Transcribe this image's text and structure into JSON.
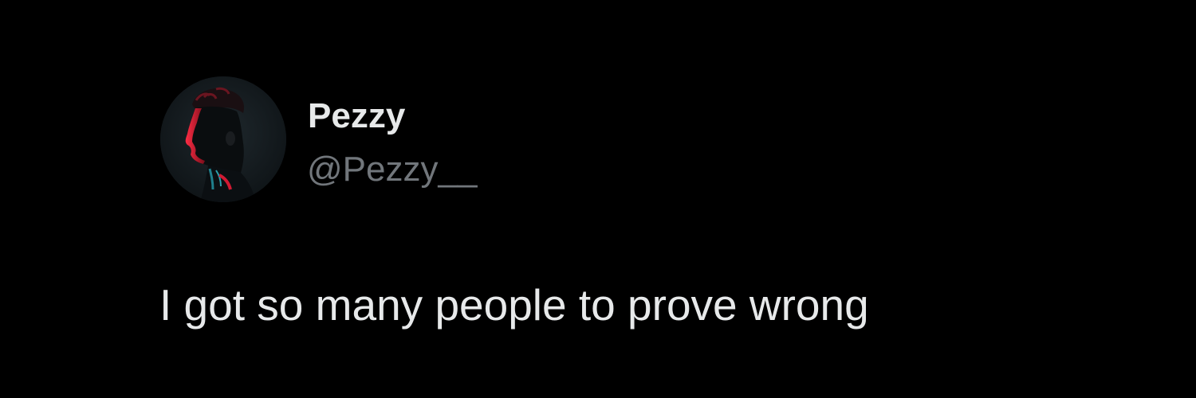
{
  "tweet": {
    "author": {
      "display_name": "Pezzy",
      "handle": "@Pezzy__",
      "avatar_icon": "profile-silhouette-icon"
    },
    "text": "I got so many people to prove wrong"
  },
  "colors": {
    "background": "#000000",
    "primary_text": "#e7e9ea",
    "secondary_text": "#71767b",
    "avatar_accent": "#e0203a"
  }
}
